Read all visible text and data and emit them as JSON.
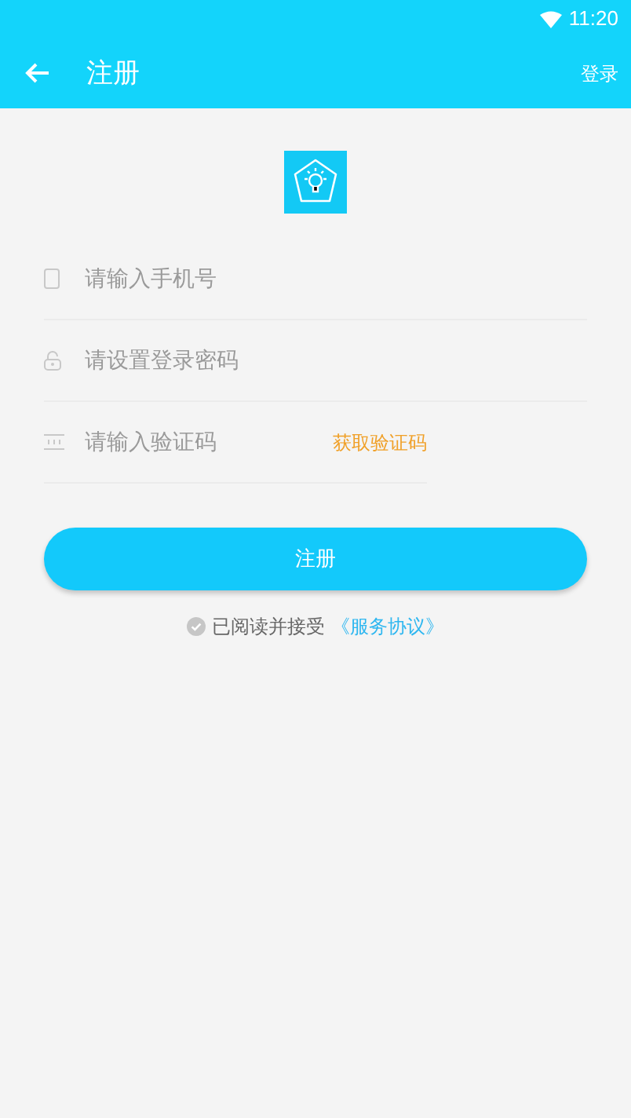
{
  "status_bar": {
    "time": "11:20"
  },
  "app_bar": {
    "title": "注册",
    "action": "登录"
  },
  "fields": [
    {
      "kind": "phone",
      "placeholder": "请输入手机号"
    },
    {
      "kind": "password",
      "placeholder": "请设置登录密码"
    },
    {
      "kind": "code",
      "placeholder": "请输入验证码",
      "action": "获取验证码"
    }
  ],
  "submit": "注册",
  "agreement": {
    "checked": false,
    "text": "已阅读并接受",
    "link": "《服务协议》"
  }
}
